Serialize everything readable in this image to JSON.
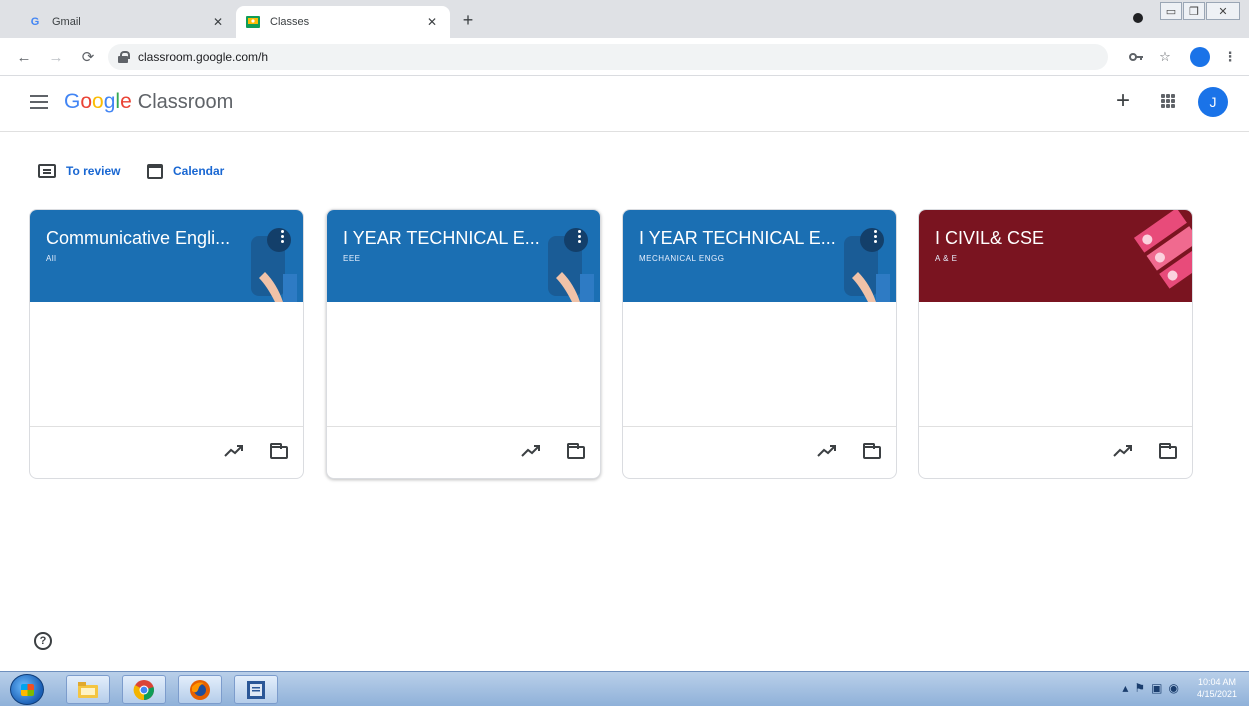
{
  "browser": {
    "tabs": [
      {
        "label": "Gmail",
        "favicon": "G"
      },
      {
        "label": "Classes",
        "favicon": "classroom-favicon"
      }
    ],
    "new_tab": "+",
    "url": "classroom.google.com/h"
  },
  "app": {
    "brand": {
      "letters": [
        "G",
        "o",
        "o",
        "g",
        "l",
        "e"
      ],
      "product": "Classroom"
    },
    "avatar_letter": "J",
    "add_label": "+"
  },
  "quick_links": {
    "to_review": "To review",
    "calendar": "Calendar"
  },
  "classes": [
    {
      "name": "Communicative Engli...",
      "section": "All",
      "color": "#1b6fb3"
    },
    {
      "name": "I YEAR TECHNICAL E...",
      "section": "EEE",
      "color": "#1b6fb3"
    },
    {
      "name": "I YEAR TECHNICAL E...",
      "section": "MECHANICAL ENGG",
      "color": "#1b6fb3"
    },
    {
      "name": "I CIVIL& CSE",
      "section": "A & E",
      "color": "#7a1420"
    }
  ],
  "help_label": "?",
  "taskbar": {
    "clock_time": "10:04 AM",
    "clock_date": "4/15/2021"
  }
}
